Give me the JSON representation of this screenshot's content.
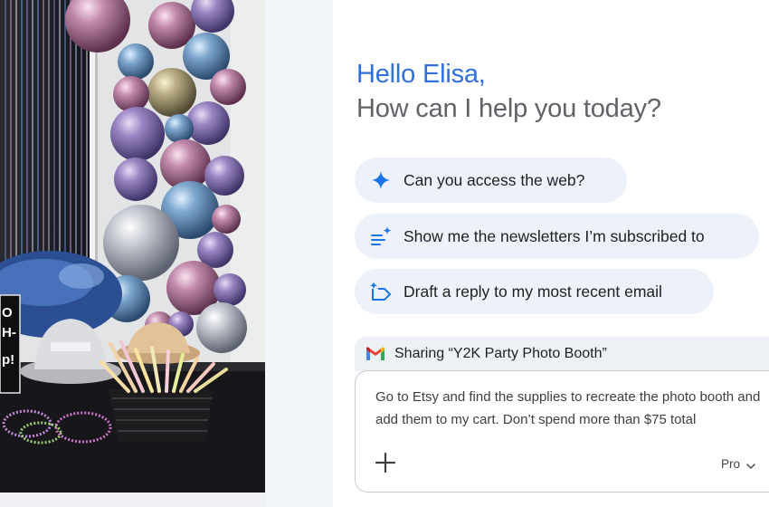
{
  "greeting": {
    "hello": "Hello Elisa,",
    "prompt": "How can I help you today?"
  },
  "suggestions": [
    {
      "icon": "sparkle-icon",
      "label": "Can you access the web?"
    },
    {
      "icon": "list-sparkle-icon",
      "label": "Show me the newsletters I’m subscribed to"
    },
    {
      "icon": "label-sparkle-icon",
      "label": "Draft a reply to my most recent email"
    }
  ],
  "sharing": {
    "icon": "gmail-icon",
    "label": "Sharing “Y2K Party Photo Booth”"
  },
  "composer": {
    "text": "Go to Etsy and find the supplies to recreate the photo booth and add them to my cart. Don’t spend more than $75 total",
    "add_icon": "plus-icon",
    "model": "Pro"
  },
  "photo": {
    "sign_lines": [
      "O",
      "H-",
      "p!"
    ]
  },
  "colors": {
    "accent_blue": "#2f6fe0",
    "chip_bg": "#edf2fa",
    "icon_blue": "#1a73e8"
  }
}
